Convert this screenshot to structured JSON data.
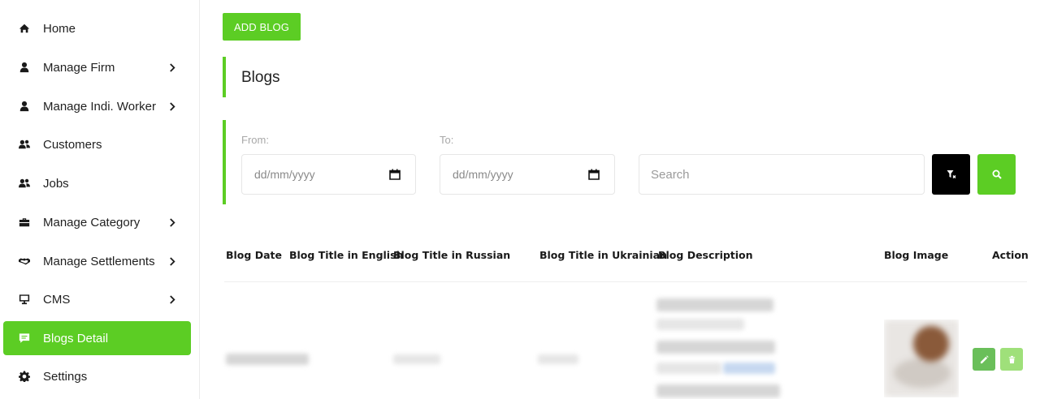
{
  "sidebar": {
    "items": [
      {
        "label": "Home",
        "icon": "home-icon",
        "chevron": false,
        "active": false
      },
      {
        "label": "Manage Firm",
        "icon": "user-icon",
        "chevron": true,
        "active": false
      },
      {
        "label": "Manage Indi. Worker",
        "icon": "user-icon",
        "chevron": true,
        "active": false
      },
      {
        "label": "Customers",
        "icon": "users-icon",
        "chevron": false,
        "active": false
      },
      {
        "label": "Jobs",
        "icon": "users-icon",
        "chevron": false,
        "active": false
      },
      {
        "label": "Manage Category",
        "icon": "briefcase-icon",
        "chevron": true,
        "active": false
      },
      {
        "label": "Manage Settlements",
        "icon": "handshake-icon",
        "chevron": true,
        "active": false
      },
      {
        "label": "CMS",
        "icon": "desktop-icon",
        "chevron": true,
        "active": false
      },
      {
        "label": "Blogs Detail",
        "icon": "comment-icon",
        "chevron": false,
        "active": true
      },
      {
        "label": "Settings",
        "icon": "gear-icon",
        "chevron": false,
        "active": false
      }
    ]
  },
  "main": {
    "add_button": "ADD BLOG",
    "title": "Blogs",
    "filters": {
      "from_label": "From:",
      "to_label": "To:",
      "date_placeholder": "dd/mm/yyyy",
      "search_placeholder": "Search"
    }
  },
  "table": {
    "columns": [
      "Blog Date",
      "Blog Title in English",
      "Blog Title in Russian",
      "Blog Title in Ukrainian",
      "Blog Description",
      "Blog Image",
      "Action"
    ]
  },
  "colors": {
    "accent": "#5ccd24",
    "clear_button": "#000000",
    "edit_button": "#6abf5a",
    "delete_button": "#9fe07a"
  }
}
